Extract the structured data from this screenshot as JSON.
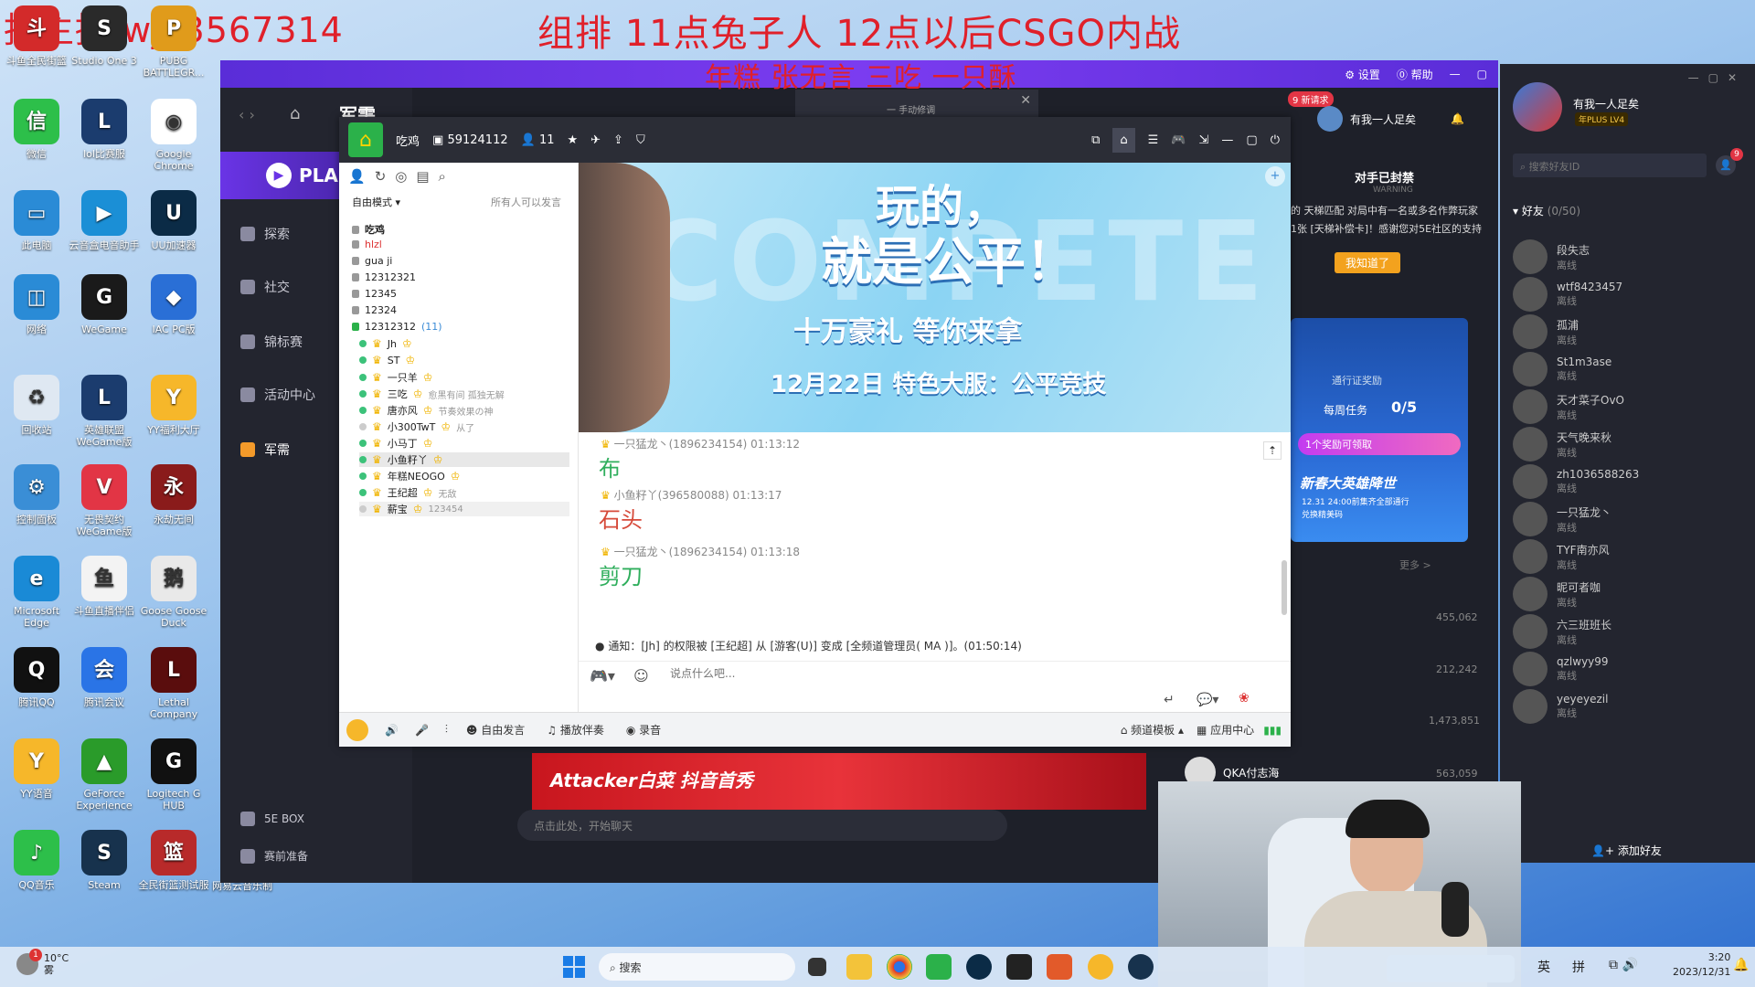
{
  "overlay": {
    "top_left": "报主播 wjc3567314",
    "center": "组排        11点兔子人    12点以后CSGO内战",
    "names": "年糕 张无言 三吃 一只酥"
  },
  "desktop": {
    "icons": [
      {
        "label": "斗鱼全民街篮",
        "color": "#d32a2a",
        "glyph": "斗"
      },
      {
        "label": "Studio One 3",
        "color": "#2a2a2a",
        "glyph": "S"
      },
      {
        "label": "PUBG BATTLEGR...",
        "color": "#e09b1b",
        "glyph": "P"
      },
      {
        "label": "微信",
        "color": "#2dbf4a",
        "glyph": "信"
      },
      {
        "label": "lol比赛服",
        "color": "#1b3c6e",
        "glyph": "L"
      },
      {
        "label": "Google Chrome",
        "color": "#ffffff",
        "glyph": "◉"
      },
      {
        "label": "此电脑",
        "color": "#2a8bd6",
        "glyph": "▭"
      },
      {
        "label": "云音盒电音助手",
        "color": "#1b8fd6",
        "glyph": "▶"
      },
      {
        "label": "UU加速器",
        "color": "#0b2b46",
        "glyph": "U"
      },
      {
        "label": "网络",
        "color": "#2a8bd6",
        "glyph": "◫"
      },
      {
        "label": "WeGame",
        "color": "#1a1a1a",
        "glyph": "G"
      },
      {
        "label": "IAC PC版",
        "color": "#2a6fd6",
        "glyph": "◆"
      },
      {
        "label": "回收站",
        "color": "#dfe8f2",
        "glyph": "♻"
      },
      {
        "label": "英雄联盟WeGame版",
        "color": "#1b3c6e",
        "glyph": "L"
      },
      {
        "label": "YY福利大厅",
        "color": "#f6b72a",
        "glyph": "Y"
      },
      {
        "label": "控制面板",
        "color": "#3a8ed6",
        "glyph": "⚙"
      },
      {
        "label": "无畏契约WeGame版",
        "color": "#e23545",
        "glyph": "V"
      },
      {
        "label": "永劫无间",
        "color": "#8a1b1b",
        "glyph": "永"
      },
      {
        "label": "Microsoft Edge",
        "color": "#1a8ad6",
        "glyph": "e"
      },
      {
        "label": "斗鱼直播伴侣",
        "color": "#f3f3f3",
        "glyph": "鱼"
      },
      {
        "label": "Goose Goose Duck",
        "color": "#e9e9e9",
        "glyph": "鹅"
      },
      {
        "label": "腾讯QQ",
        "color": "#111111",
        "glyph": "Q"
      },
      {
        "label": "腾讯会议",
        "color": "#2a74e6",
        "glyph": "会"
      },
      {
        "label": "Lethal Company",
        "color": "#5a0d0d",
        "glyph": "L"
      },
      {
        "label": "YY语音",
        "color": "#f6b72a",
        "glyph": "Y"
      },
      {
        "label": "GeForce Experience",
        "color": "#2a9b2a",
        "glyph": "▲"
      },
      {
        "label": "Logitech G HUB",
        "color": "#111111",
        "glyph": "G"
      },
      {
        "label": "QQ音乐",
        "color": "#2dbf4a",
        "glyph": "♪"
      },
      {
        "label": "Steam",
        "color": "#17324d",
        "glyph": "S"
      },
      {
        "label": "全民街篮测试服",
        "color": "#b82a2a",
        "glyph": "篮"
      }
    ],
    "extra_label": "网易云音乐制"
  },
  "win5e": {
    "settings": "设置",
    "help": "帮助",
    "page_title": "军需",
    "play_label": "PLA",
    "nav": [
      "探索",
      "社交",
      "锦标赛",
      "活动中心",
      "军需"
    ],
    "nav_bottom": [
      "5E BOX",
      "赛前准备"
    ],
    "new_request": "9 新请求",
    "username": "有我一人足矣",
    "banned_title": "对手已封禁",
    "banned_sub": "WARNING",
    "banned_text1": "的 天梯匹配 对局中有一名或多名作弊玩家",
    "banned_text2": "1张 [天梯补偿卡]！感谢您对5E社区的支持",
    "banned_btn": "我知道了",
    "promo_reward": "通行证奖励",
    "promo_daily": "每周任务",
    "promo_daily_value": "0/5",
    "promo_claim": "1个奖励可领取",
    "promo_big": "新春大英雄降世",
    "promo_date": "12.31 24:00前集齐全部通行",
    "promo_code": "兑换精美码",
    "more": "更多 >",
    "view_counts": [
      "455,062",
      "212,242",
      "1,473,851",
      "563,059"
    ],
    "streamer": "QKA付志海",
    "chat_placeholder": "点击此处，开始聊天",
    "banner_text": "Attacker白菜 抖音首秀"
  },
  "yy": {
    "channel_name": "吃鸡",
    "channel_id": "59124112",
    "online_count": "11",
    "popup_text": "一 手动修调",
    "mode": "自由模式",
    "permission": "所有人可以发言",
    "channels": [
      "吃鸡",
      "hlzl",
      "gua ji",
      "12312321",
      "12345",
      "12324",
      "12312312"
    ],
    "active_channel": "12312312",
    "active_count": "(11)",
    "members": [
      {
        "name": "Jh",
        "note": ""
      },
      {
        "name": "ST",
        "note": ""
      },
      {
        "name": "一只羊",
        "note": ""
      },
      {
        "name": "三吃",
        "note": "愈黑有间  孤独无解"
      },
      {
        "name": "唐亦风",
        "note": "节奏效果の神"
      },
      {
        "name": "小300TwT",
        "note": "从了"
      },
      {
        "name": "小马丁",
        "note": ""
      },
      {
        "name": "小鱼籽丫",
        "note": ""
      },
      {
        "name": "年糕NEOGO",
        "note": ""
      },
      {
        "name": "王纪超",
        "note": "无敌"
      },
      {
        "name": "薪宝",
        "note": "123454"
      }
    ],
    "banner": {
      "line1": "玩的，",
      "line2": "就是公平！",
      "line3": "十万豪礼 等你来拿",
      "line4": "12月22日  特色大服：公平竞技",
      "bg_word": "COMPETE"
    },
    "messages": [
      {
        "sender": "一只猛龙丶(1896234154)",
        "time": "01:13:12",
        "text": "布",
        "color": "#2fae5c"
      },
      {
        "sender": "小鱼籽丫(396580088)",
        "time": "01:13:17",
        "text": "石头",
        "color": "#d64a3a"
      },
      {
        "sender": "一只猛龙丶(1896234154)",
        "time": "01:13:18",
        "text": "剪刀",
        "color": "#2fae5c"
      }
    ],
    "notice": "通知：[Jh] 的权限被 [王纪超] 从 [游客(U)] 变成 [全频道管理员( MA )]。(01:50:14)",
    "input_placeholder": "说点什么吧...",
    "bottom": {
      "free_speak": "自由发言",
      "music": "播放伴奏",
      "record": "录音",
      "template": "频道模板",
      "app_center": "应用中心"
    }
  },
  "friends": {
    "username": "有我一人足矣",
    "vip": "年PLUS LV4",
    "search_placeholder": "搜索好友ID",
    "badge": "9",
    "group": "好友",
    "group_count": "(0/50)",
    "list": [
      {
        "name": "段失志",
        "status": "离线"
      },
      {
        "name": "wtf8423457",
        "status": "离线"
      },
      {
        "name": "孤浦",
        "status": "离线"
      },
      {
        "name": "St1m3ase",
        "status": "离线"
      },
      {
        "name": "天才菜子OvO",
        "status": "离线"
      },
      {
        "name": "天气晚来秋",
        "status": "离线"
      },
      {
        "name": "zh1036588263",
        "status": "离线"
      },
      {
        "name": "一只猛龙丶",
        "status": "离线"
      },
      {
        "name": "TYF南亦风",
        "status": "离线"
      },
      {
        "name": "昵可者咖",
        "status": "离线"
      },
      {
        "name": "六三班班长",
        "status": "离线"
      },
      {
        "name": "qzlwyy99",
        "status": "离线"
      },
      {
        "name": "yeyeyezil",
        "status": "离线"
      }
    ],
    "add_friend": "添加好友"
  },
  "taskbar": {
    "weather_temp": "10°C",
    "weather_desc": "雾",
    "weather_badge": "1",
    "search": "搜索",
    "ime1": "英",
    "ime2": "拼",
    "time": "3:20",
    "date": "2023/12/31"
  },
  "colors": {
    "accent_purple": "#6a34e6",
    "overlay_red": "#e0202a",
    "yy_dark": "#2b2d36",
    "online_green": "#3cc27a"
  }
}
